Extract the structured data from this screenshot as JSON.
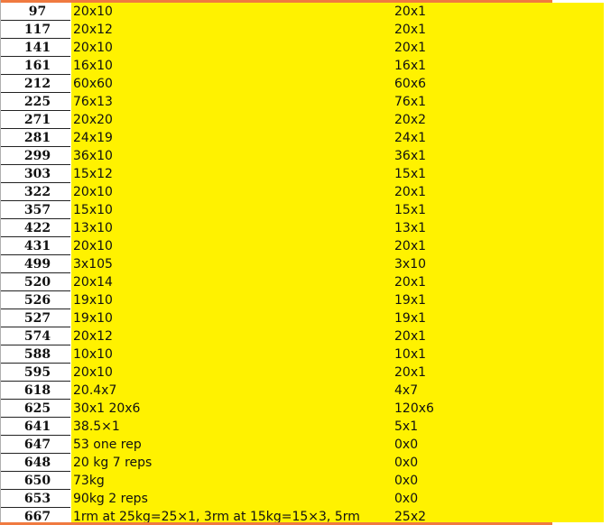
{
  "colors": {
    "highlight": "#fff200",
    "accent_bar": "#f07a40",
    "text": "#111111"
  },
  "rows": [
    {
      "id": "97",
      "a": "20x10",
      "b": "20x1"
    },
    {
      "id": "117",
      "a": "20x12",
      "b": "20x1"
    },
    {
      "id": "141",
      "a": "20x10",
      "b": "20x1"
    },
    {
      "id": "161",
      "a": "16x10",
      "b": "16x1"
    },
    {
      "id": "212",
      "a": "60x60",
      "b": "60x6"
    },
    {
      "id": "225",
      "a": "76x13",
      "b": "76x1"
    },
    {
      "id": "271",
      "a": "20x20",
      "b": "20x2"
    },
    {
      "id": "281",
      "a": "24x19",
      "b": "24x1"
    },
    {
      "id": "299",
      "a": "36x10",
      "b": "36x1"
    },
    {
      "id": "303",
      "a": "15x12",
      "b": "15x1"
    },
    {
      "id": "322",
      "a": "20x10",
      "b": "20x1"
    },
    {
      "id": "357",
      "a": "15x10",
      "b": "15x1"
    },
    {
      "id": "422",
      "a": "13x10",
      "b": "13x1"
    },
    {
      "id": "431",
      "a": "20x10",
      "b": "20x1"
    },
    {
      "id": "499",
      "a": "3x105",
      "b": "3x10"
    },
    {
      "id": "520",
      "a": "20x14",
      "b": "20x1"
    },
    {
      "id": "526",
      "a": "19x10",
      "b": "19x1"
    },
    {
      "id": "527",
      "a": "19x10",
      "b": "19x1"
    },
    {
      "id": "574",
      "a": "20x12",
      "b": "20x1"
    },
    {
      "id": "588",
      "a": "10x10",
      "b": "10x1"
    },
    {
      "id": "595",
      "a": "20x10",
      "b": "20x1"
    },
    {
      "id": "618",
      "a": "20.4x7",
      "b": "4x7"
    },
    {
      "id": "625",
      "a": "30x1 20x6",
      "b": "120x6"
    },
    {
      "id": "641",
      "a": "38.5×1",
      "b": "5x1"
    },
    {
      "id": "647",
      "a": "53 one rep",
      "b": "0x0"
    },
    {
      "id": "648",
      "a": "20 kg 7 reps",
      "b": "0x0"
    },
    {
      "id": "650",
      "a": "73kg",
      "b": "0x0"
    },
    {
      "id": "653",
      "a": "90kg 2 reps",
      "b": "0x0"
    },
    {
      "id": "667",
      "a": "1rm at 25kg=25×1, 3rm at 15kg=15×3, 5rm",
      "b": "25x2"
    }
  ]
}
